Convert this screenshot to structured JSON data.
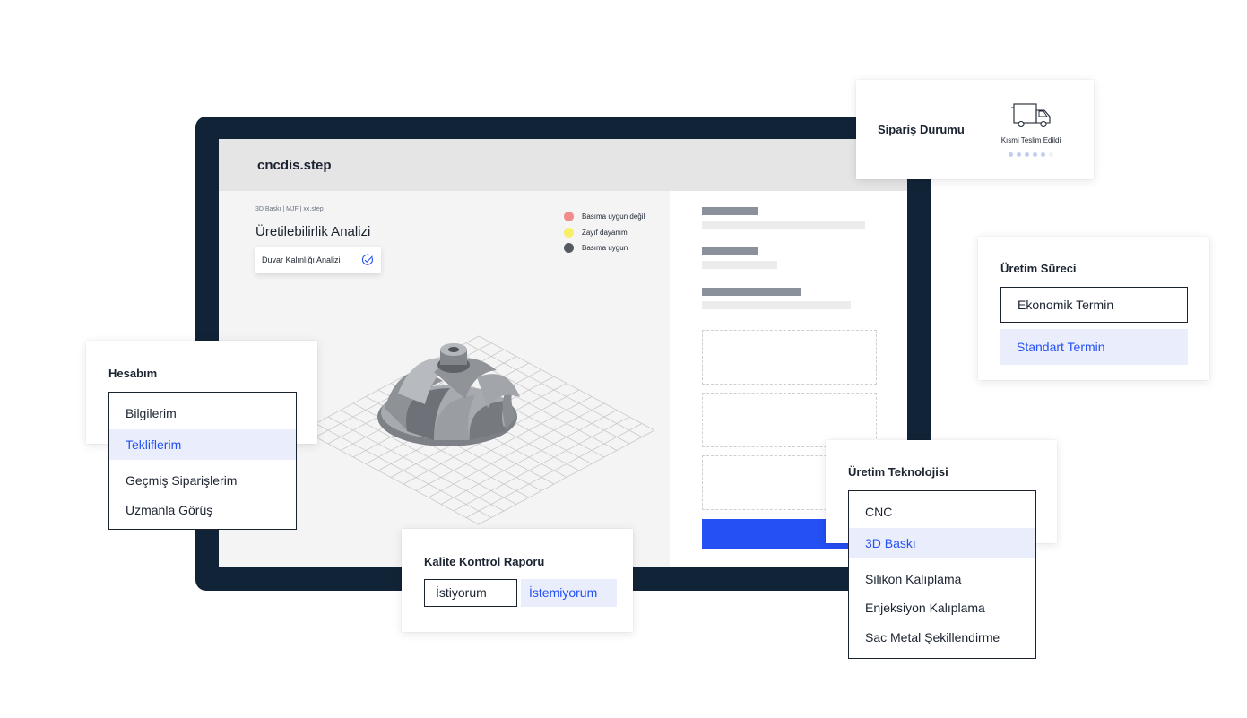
{
  "screen": {
    "file_title": "cncdis.step",
    "breadcrumb": "3D Baskı | MJF | xx.step",
    "analysis_title": "Üretilebilirlik Analizi",
    "wall_analysis_label": "Duvar Kalınlığı Analizi",
    "legend": [
      {
        "label": "Basıma uygun değil",
        "color": "#f28b8b"
      },
      {
        "label": "Zayıf dayanım",
        "color": "#f7ef6a"
      },
      {
        "label": "Basıma uygun",
        "color": "#555a60"
      }
    ]
  },
  "order_status": {
    "title": "Sipariş Durumu",
    "status_text": "Kısmi Teslim Edildi",
    "progress_steps_total": 6,
    "progress_steps_done": 5,
    "icon": "truck-icon"
  },
  "account": {
    "title": "Hesabım",
    "items": [
      "Bilgilerim",
      "Tekliflerim",
      "Geçmiş Siparişlerim",
      "Uzmanla Görüş"
    ],
    "selected": "Tekliflerim"
  },
  "production_process": {
    "title": "Üretim Süreci",
    "options": [
      "Ekonomik Termin",
      "Standart Termin"
    ],
    "selected": "Standart Termin"
  },
  "production_technology": {
    "title": "Üretim Teknolojisi",
    "items": [
      "CNC",
      "3D Baskı",
      "Silikon Kalıplama",
      "Enjeksiyon Kalıplama",
      "Sac Metal Şekillendirme"
    ],
    "selected": "3D Baskı"
  },
  "quality_report": {
    "title": "Kalite Kontrol Raporu",
    "options": [
      "İstiyorum",
      "İstemiyorum"
    ],
    "selected": "İstemiyorum"
  },
  "colors": {
    "accent_blue": "#2450f4",
    "selected_bg": "#eaeefc",
    "monitor_frame": "#112336"
  }
}
